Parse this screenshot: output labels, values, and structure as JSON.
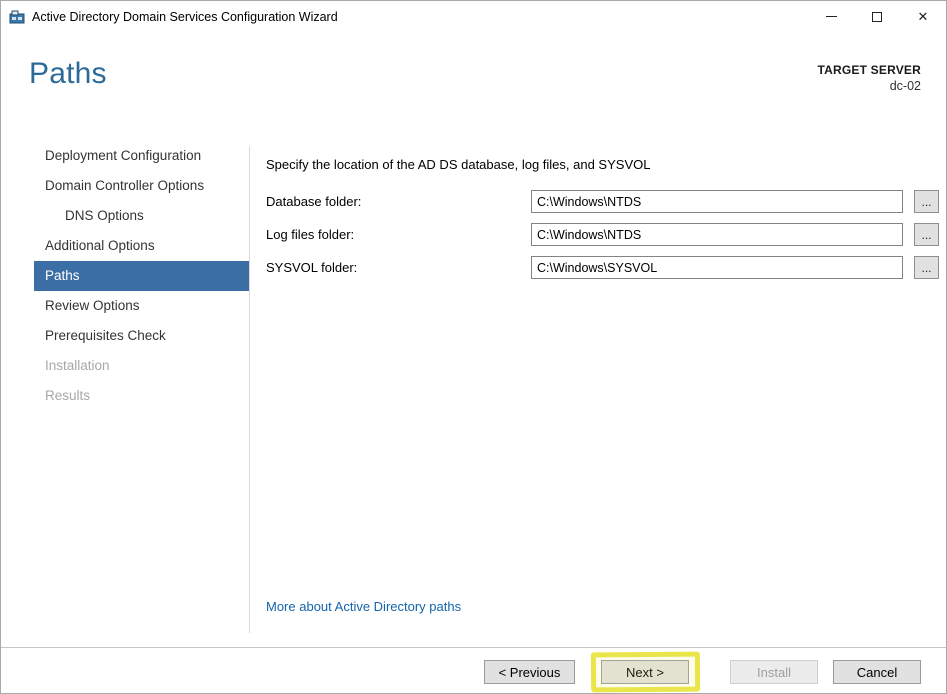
{
  "window": {
    "title": "Active Directory Domain Services Configuration Wizard",
    "close_glyph": "✕"
  },
  "header": {
    "page_title": "Paths",
    "target_server_label": "TARGET SERVER",
    "target_server_name": "dc-02"
  },
  "sidebar": {
    "items": [
      {
        "label": "Deployment Configuration",
        "state": "normal"
      },
      {
        "label": "Domain Controller Options",
        "state": "normal"
      },
      {
        "label": "DNS Options",
        "state": "normal",
        "indent": true
      },
      {
        "label": "Additional Options",
        "state": "normal"
      },
      {
        "label": "Paths",
        "state": "selected"
      },
      {
        "label": "Review Options",
        "state": "normal"
      },
      {
        "label": "Prerequisites Check",
        "state": "normal"
      },
      {
        "label": "Installation",
        "state": "disabled"
      },
      {
        "label": "Results",
        "state": "disabled"
      }
    ]
  },
  "content": {
    "instruction": "Specify the location of the AD DS database, log files, and SYSVOL",
    "browse_label": "...",
    "fields": [
      {
        "label": "Database folder:",
        "value": "C:\\Windows\\NTDS"
      },
      {
        "label": "Log files folder:",
        "value": "C:\\Windows\\NTDS"
      },
      {
        "label": "SYSVOL folder:",
        "value": "C:\\Windows\\SYSVOL"
      }
    ],
    "more_link": "More about Active Directory paths"
  },
  "footer": {
    "previous": "< Previous",
    "next": "Next >",
    "install": "Install",
    "cancel": "Cancel"
  },
  "colors": {
    "accent_blue": "#2b6a99",
    "selected_blue": "#3a6ea5",
    "link_blue": "#1464ad",
    "highlight_yellow": "#e8e33a"
  },
  "annotation": {
    "type": "marker-highlight",
    "target": "next-button"
  }
}
